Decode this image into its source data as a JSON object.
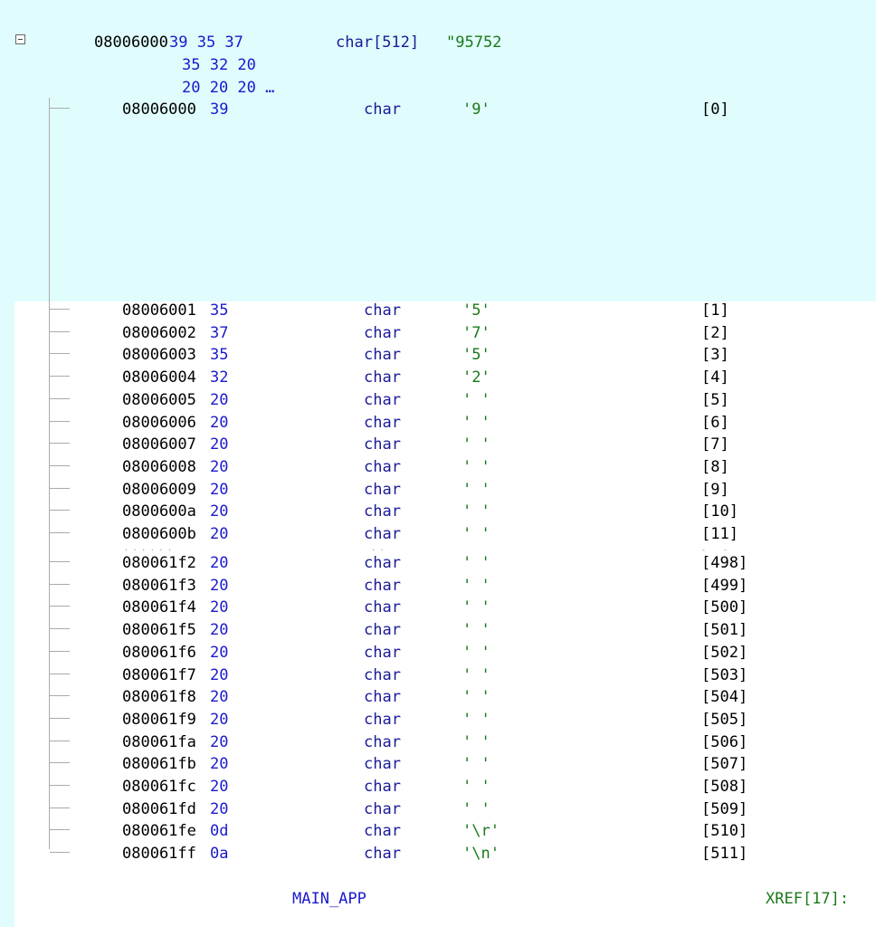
{
  "header": {
    "addr": "08006000",
    "bytes_line1": "39 35 37",
    "bytes_line2": "35 32 20",
    "bytes_line3": "20 20 20 …",
    "type": "char[512]",
    "value": "\"95752"
  },
  "rows": [
    {
      "addr": "08006000",
      "byte": "39",
      "type": "char",
      "value": "'9'",
      "index": "[0]"
    },
    {
      "addr": "08006001",
      "byte": "35",
      "type": "char",
      "value": "'5'",
      "index": "[1]"
    },
    {
      "addr": "08006002",
      "byte": "37",
      "type": "char",
      "value": "'7'",
      "index": "[2]"
    },
    {
      "addr": "08006003",
      "byte": "35",
      "type": "char",
      "value": "'5'",
      "index": "[3]"
    },
    {
      "addr": "08006004",
      "byte": "32",
      "type": "char",
      "value": "'2'",
      "index": "[4]"
    },
    {
      "addr": "08006005",
      "byte": "20",
      "type": "char",
      "value": "' '",
      "index": "[5]"
    },
    {
      "addr": "08006006",
      "byte": "20",
      "type": "char",
      "value": "' '",
      "index": "[6]"
    },
    {
      "addr": "08006007",
      "byte": "20",
      "type": "char",
      "value": "' '",
      "index": "[7]"
    },
    {
      "addr": "08006008",
      "byte": "20",
      "type": "char",
      "value": "' '",
      "index": "[8]"
    },
    {
      "addr": "08006009",
      "byte": "20",
      "type": "char",
      "value": "' '",
      "index": "[9]"
    },
    {
      "addr": "0800600a",
      "byte": "20",
      "type": "char",
      "value": "' '",
      "index": "[10]"
    },
    {
      "addr": "0800600b",
      "byte": "20",
      "type": "char",
      "value": "' '",
      "index": "[11]"
    },
    {
      "addr": "080061f2",
      "byte": "20",
      "type": "char",
      "value": "' '",
      "index": "[498]"
    },
    {
      "addr": "080061f3",
      "byte": "20",
      "type": "char",
      "value": "' '",
      "index": "[499]"
    },
    {
      "addr": "080061f4",
      "byte": "20",
      "type": "char",
      "value": "' '",
      "index": "[500]"
    },
    {
      "addr": "080061f5",
      "byte": "20",
      "type": "char",
      "value": "' '",
      "index": "[501]"
    },
    {
      "addr": "080061f6",
      "byte": "20",
      "type": "char",
      "value": "' '",
      "index": "[502]"
    },
    {
      "addr": "080061f7",
      "byte": "20",
      "type": "char",
      "value": "' '",
      "index": "[503]"
    },
    {
      "addr": "080061f8",
      "byte": "20",
      "type": "char",
      "value": "' '",
      "index": "[504]"
    },
    {
      "addr": "080061f9",
      "byte": "20",
      "type": "char",
      "value": "' '",
      "index": "[505]"
    },
    {
      "addr": "080061fa",
      "byte": "20",
      "type": "char",
      "value": "' '",
      "index": "[506]"
    },
    {
      "addr": "080061fb",
      "byte": "20",
      "type": "char",
      "value": "' '",
      "index": "[507]"
    },
    {
      "addr": "080061fc",
      "byte": "20",
      "type": "char",
      "value": "' '",
      "index": "[508]"
    },
    {
      "addr": "080061fd",
      "byte": "20",
      "type": "char",
      "value": "' '",
      "index": "[509]"
    },
    {
      "addr": "080061fe",
      "byte": "0d",
      "type": "char",
      "value": "'\\r'",
      "index": "[510]"
    },
    {
      "addr": "080061ff",
      "byte": "0a",
      "type": "char",
      "value": "'\\n'",
      "index": "[511]"
    }
  ],
  "footer": {
    "label": "MAIN_APP",
    "xref": "XREF[17]:"
  },
  "colors": {
    "highlight": "#e0fcfc",
    "byte": "#1a1acc",
    "keyword": "#1a1a99",
    "string": "#1a7a1a"
  }
}
